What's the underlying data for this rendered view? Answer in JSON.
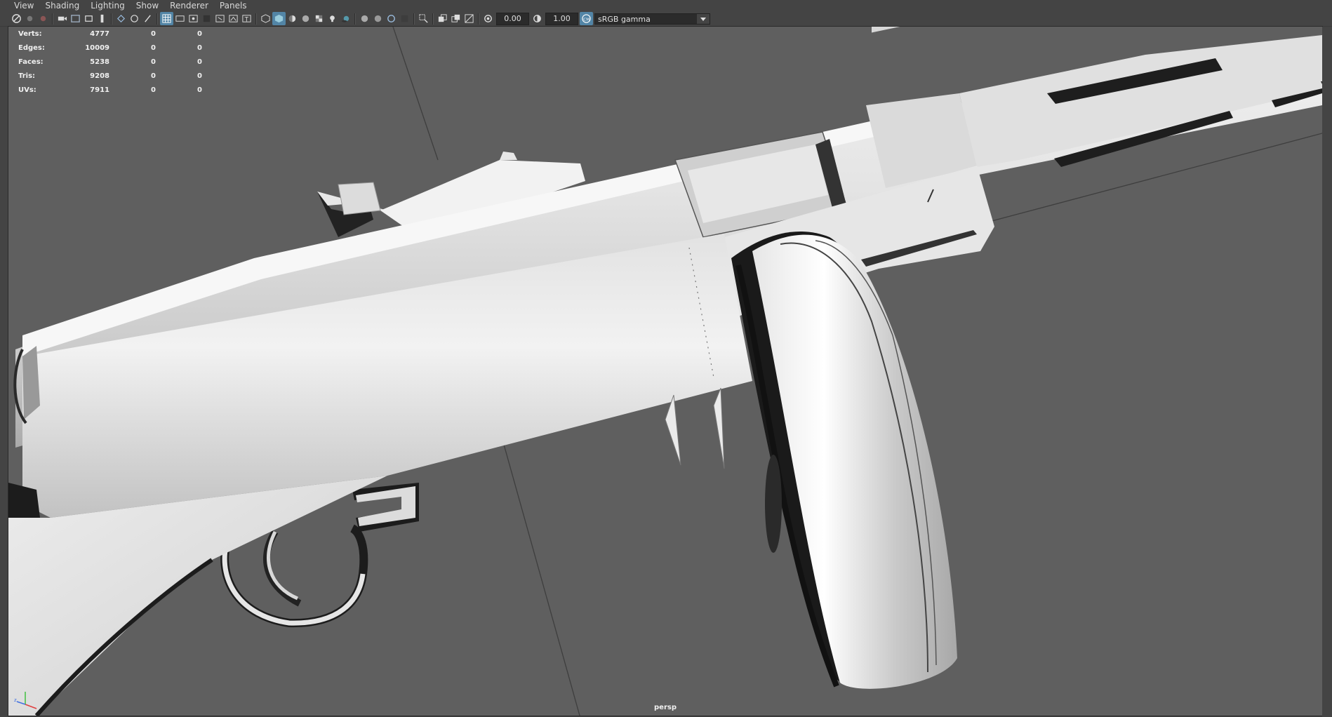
{
  "menu": [
    "View",
    "Shading",
    "Lighting",
    "Show",
    "Renderer",
    "Panels"
  ],
  "toolbar": {
    "exposure_value": "0.00",
    "gamma_value": "1.00",
    "color_space": "sRGB gamma"
  },
  "hud": {
    "rows": [
      {
        "label": "Verts:",
        "values": [
          "4777",
          "0",
          "0"
        ]
      },
      {
        "label": "Edges:",
        "values": [
          "10009",
          "0",
          "0"
        ]
      },
      {
        "label": "Faces:",
        "values": [
          "5238",
          "0",
          "0"
        ]
      },
      {
        "label": "Tris:",
        "values": [
          "9208",
          "0",
          "0"
        ]
      },
      {
        "label": "UVs:",
        "values": [
          "7911",
          "0",
          "0"
        ]
      }
    ]
  },
  "viewport": {
    "camera": "persp",
    "background_color": "#5f5f5f",
    "model_color": "#dcdcdc"
  },
  "icons": [
    "select-camera-icon",
    "camera-attributes-icon",
    "bookmark-icon",
    "image-plane-icon",
    "2d-pan-zoom-icon",
    "grease-pencil-icon",
    "grid-icon",
    "film-gate-icon",
    "resolution-gate-icon",
    "gate-mask-icon",
    "field-chart-icon",
    "safe-action-icon",
    "safe-title-icon",
    "wireframe-icon",
    "smooth-shade-icon",
    "default-material-icon",
    "textured-icon",
    "use-all-lights-icon",
    "shadows-icon",
    "screen-space-ao-icon",
    "motion-blur-icon",
    "anti-alias-icon",
    "depth-of-field-icon",
    "isolate-select-icon",
    "xray-icon",
    "xray-joints-icon",
    "backface-culling-icon",
    "exposure-icon",
    "gamma-icon",
    "color-management-icon"
  ]
}
